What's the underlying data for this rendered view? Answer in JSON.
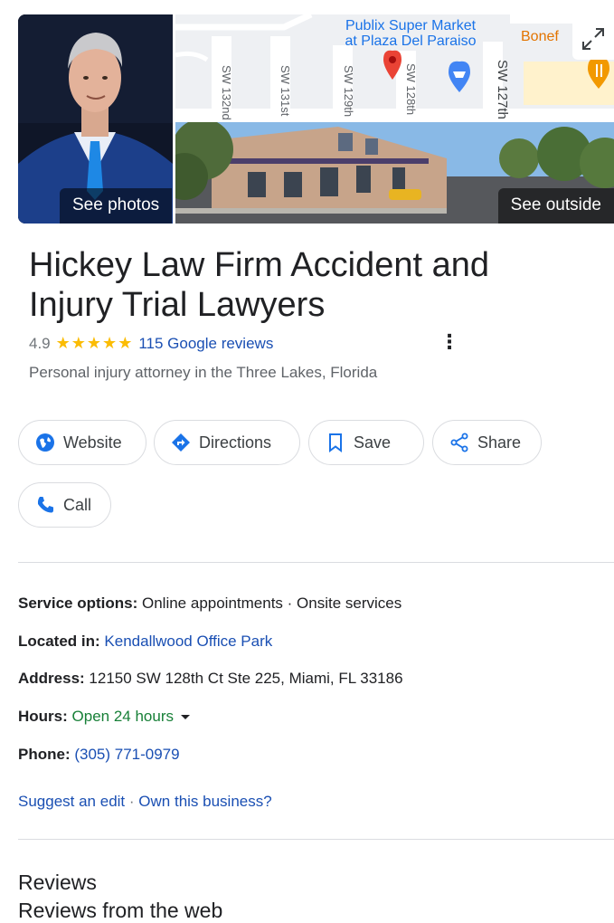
{
  "media": {
    "photos_label": "See photos",
    "outside_label": "See outside",
    "map": {
      "poi_name_line1": "Publix Super Market",
      "poi_name_line2": "at Plaza Del Paraiso",
      "poi_partial": "Bonef",
      "streets": [
        "SW 132nd",
        "SW 131st",
        "SW 129th",
        "SW 128th",
        "SW 127th"
      ]
    }
  },
  "business": {
    "name": "Hickey Law Firm Accident and Injury Trial Lawyers",
    "rating": "4.9",
    "stars": "★★★★★",
    "reviews_link": "115 Google reviews",
    "category": "Personal injury attorney in the Three Lakes, Florida"
  },
  "actions": {
    "website": "Website",
    "directions": "Directions",
    "save": "Save",
    "share": "Share",
    "call": "Call"
  },
  "info": {
    "service_label": "Service options:",
    "service_value": "Online appointments · Onsite services",
    "located_label": "Located in:",
    "located_value": "Kendallwood Office Park",
    "address_label": "Address:",
    "address_value": "12150 SW 128th Ct Ste 225, Miami, FL 33186",
    "hours_label": "Hours:",
    "hours_value": "Open 24 hours",
    "phone_label": "Phone:",
    "phone_value": "(305) 771-0979",
    "suggest_edit": "Suggest an edit",
    "separator": "·",
    "own_business": "Own this business?"
  },
  "reviews": {
    "heading": "Reviews",
    "subheading": "Reviews from the web"
  },
  "colors": {
    "link": "#1a4fb3",
    "star": "#fbbc04",
    "open": "#188038",
    "icon_blue": "#1a73e8",
    "pin_red": "#ea4335"
  }
}
